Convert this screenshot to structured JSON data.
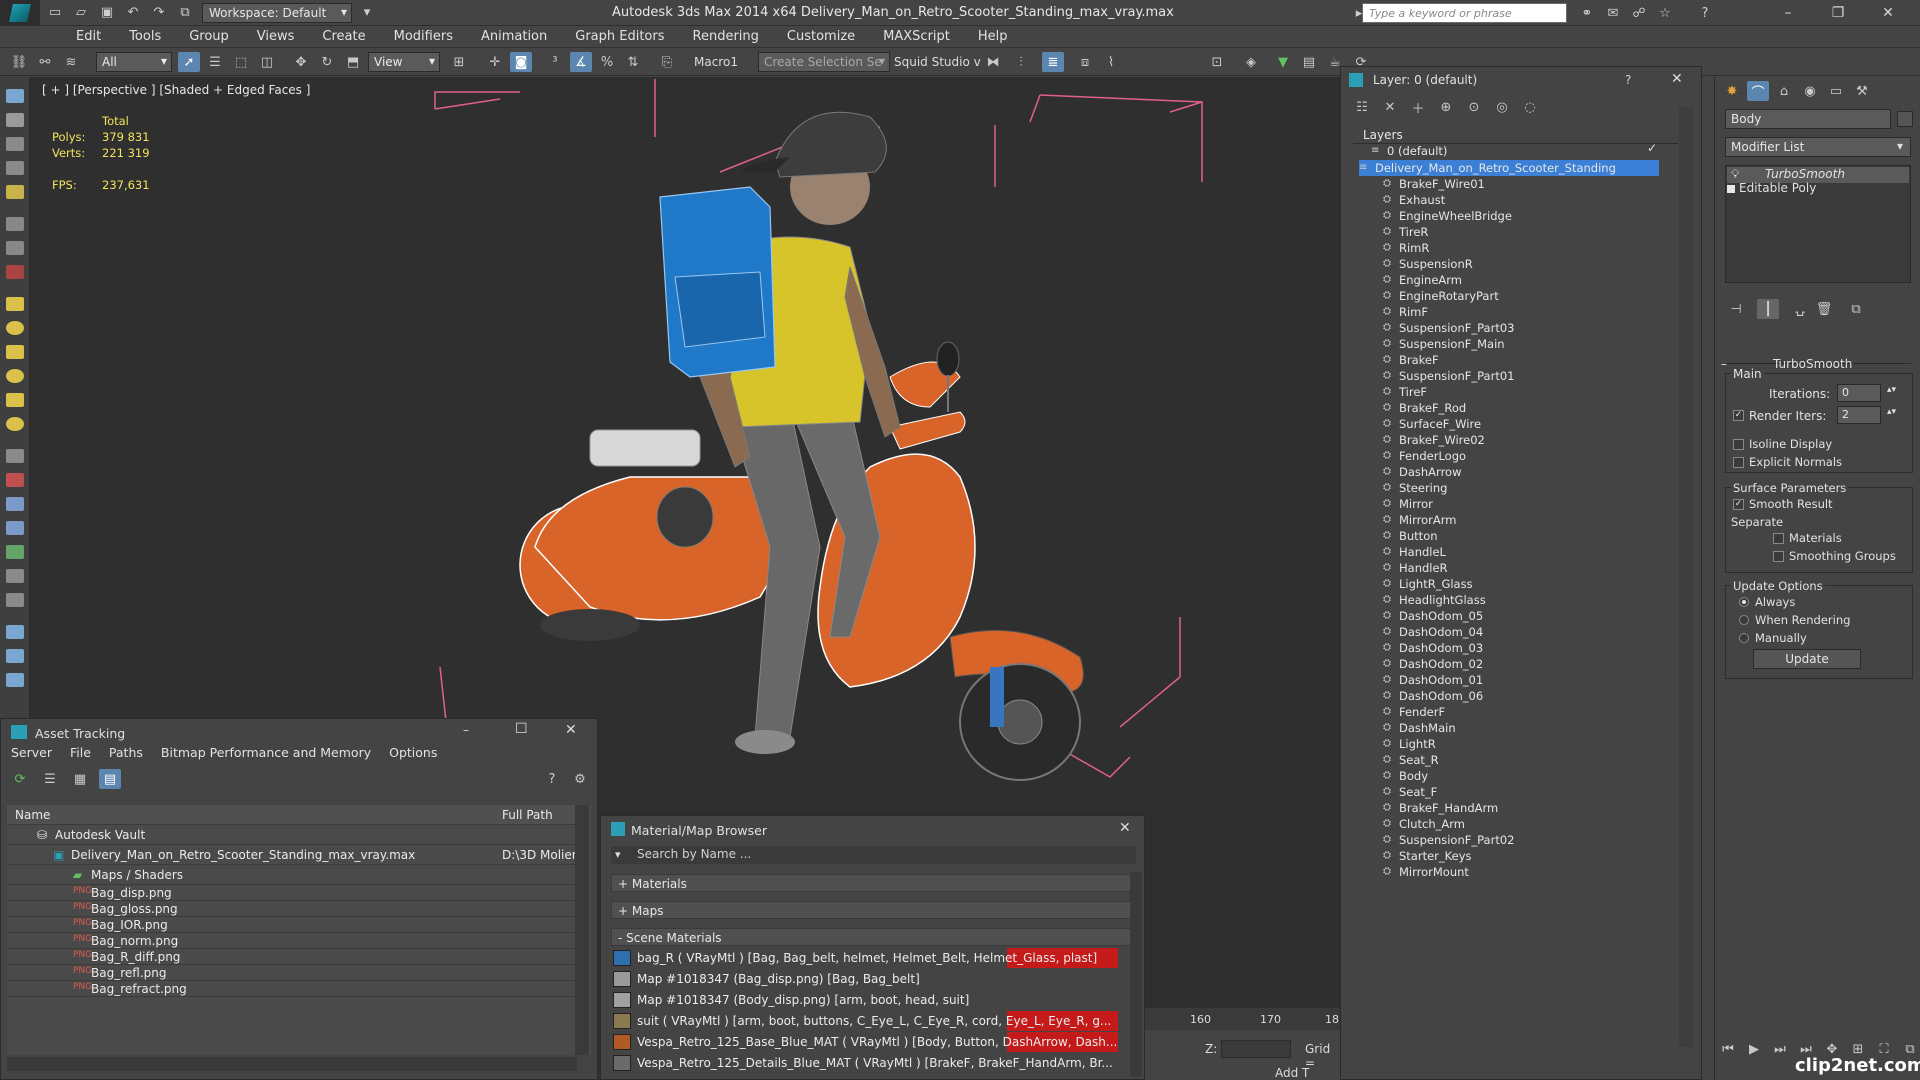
{
  "titlebar": {
    "workspace": "Workspace: Default",
    "app_title": "Autodesk 3ds Max  2014 x64     Delivery_Man_on_Retro_Scooter_Standing_max_vray.max",
    "search_placeholder": "Type a keyword or phrase"
  },
  "menu": [
    "Edit",
    "Tools",
    "Group",
    "Views",
    "Create",
    "Modifiers",
    "Animation",
    "Graph Editors",
    "Rendering",
    "Customize",
    "MAXScript",
    "Help"
  ],
  "toolbar": {
    "filter": "All",
    "view": "View",
    "macro": "Macro1",
    "selection_set": "Create Selection Se",
    "squid": "Squid Studio v"
  },
  "viewport": {
    "label": "[ + ] [Perspective ] [Shaded + Edged Faces ]",
    "stats_header": "Total",
    "polys_label": "Polys:",
    "polys": "379 831",
    "verts_label": "Verts:",
    "verts": "221 319",
    "fps_label": "FPS:",
    "fps": "237,631"
  },
  "layer_panel": {
    "title": "Layer: 0 (default)",
    "help": "?",
    "header": "Layers",
    "default_layer": "0 (default)",
    "selected_layer": "Delivery_Man_on_Retro_Scooter_Standing",
    "objects": [
      "BrakeF_Wire01",
      "Exhaust",
      "EngineWheelBridge",
      "TireR",
      "RimR",
      "SuspensionR",
      "EngineArm",
      "EngineRotaryPart",
      "RimF",
      "SuspensionF_Part03",
      "SuspensionF_Main",
      "BrakeF",
      "SuspensionF_Part01",
      "TireF",
      "BrakeF_Rod",
      "SurfaceF_Wire",
      "BrakeF_Wire02",
      "FenderLogo",
      "DashArrow",
      "Steering",
      "Mirror",
      "MirrorArm",
      "Button",
      "HandleL",
      "HandleR",
      "LightR_Glass",
      "HeadlightGlass",
      "DashOdom_05",
      "DashOdom_04",
      "DashOdom_03",
      "DashOdom_02",
      "DashOdom_01",
      "DashOdom_06",
      "FenderF",
      "DashMain",
      "LightR",
      "Seat_R",
      "Body",
      "Seat_F",
      "BrakeF_HandArm",
      "Clutch_Arm",
      "SuspensionF_Part02",
      "Starter_Keys",
      "MirrorMount"
    ]
  },
  "command_panel": {
    "object_name": "Body",
    "modifier_list": "Modifier List",
    "stack": [
      "TurboSmooth",
      "Editable Poly"
    ],
    "rollout_title": "TurboSmooth",
    "main_label": "Main",
    "iterations_label": "Iterations:",
    "iterations": "0",
    "render_iters_label": "Render Iters:",
    "render_iters": "2",
    "isoline": "Isoline Display",
    "explicit_normals": "Explicit Normals",
    "surface_params": "Surface Parameters",
    "smooth_result": "Smooth Result",
    "separate": "Separate",
    "materials": "Materials",
    "smoothing_groups": "Smoothing Groups",
    "update_options": "Update Options",
    "always": "Always",
    "when_rendering": "When Rendering",
    "manually": "Manually",
    "update_btn": "Update"
  },
  "asset_tracking": {
    "title": "Asset Tracking",
    "menu": [
      "Server",
      "File",
      "Paths",
      "Bitmap Performance and Memory",
      "Options"
    ],
    "col_name": "Name",
    "col_path": "Full Path",
    "vault": "Autodesk Vault",
    "file": "Delivery_Man_on_Retro_Scooter_Standing_max_vray.max",
    "file_path": "D:\\3D Molier",
    "maps_folder": "Maps / Shaders",
    "maps": [
      "Bag_disp.png",
      "Bag_gloss.png",
      "Bag_IOR.png",
      "Bag_norm.png",
      "Bag_R_diff.png",
      "Bag_refl.png",
      "Bag_refract.png"
    ]
  },
  "material_browser": {
    "title": "Material/Map Browser",
    "search_placeholder": "Search by Name ...",
    "sections": [
      "+ Materials",
      "+ Maps",
      "- Scene Materials"
    ],
    "items": [
      {
        "text": "bag_R  ( VRayMtl )  [Bag, Bag_belt, helmet, Helmet_Belt, Helmet_Glass, plast]",
        "swatch": "#2f6fb0"
      },
      {
        "text": "Map #1018347 (Bag_disp.png) [Bag, Bag_belt]",
        "swatch": "#9a9a9a"
      },
      {
        "text": "Map #1018347 (Body_disp.png) [arm, boot, head, suit]",
        "swatch": "#a0a0a0"
      },
      {
        "text": "suit  ( VRayMtl )  [arm, boot, buttons, C_Eye_L, C_Eye_R, cord, Eye_L, Eye_R, g...",
        "swatch": "#8a7a50"
      },
      {
        "text": "Vespa_Retro_125_Base_Blue_MAT  ( VRayMtl )  [Body, Button, DashArrow, Dash...",
        "swatch": "#b05a28"
      },
      {
        "text": "Vespa_Retro_125_Details_Blue_MAT  ( VRayMtl )  [BrakeF, BrakeF_HandArm, Br...",
        "swatch": "#6a6a6a"
      }
    ]
  },
  "timeline": {
    "tick_160": "160",
    "tick_170": "170",
    "tick_18": "18",
    "z_label": "Z:",
    "grid": "Grid =",
    "add_t": "Add T"
  },
  "watermark": "clip2net.com"
}
